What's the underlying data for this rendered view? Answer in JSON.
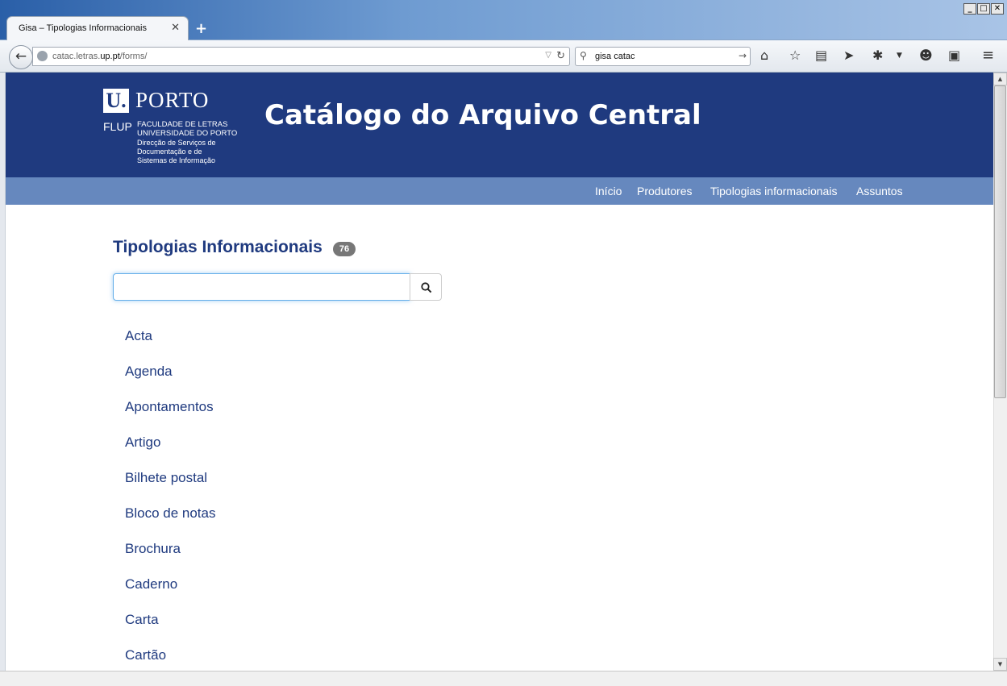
{
  "browser": {
    "tab_title": "Gisa – Tipologias Informacionais",
    "tab_close": "✕",
    "new_tab": "+",
    "url_prefix": "catac.letras.",
    "url_domain": "up.pt",
    "url_suffix": "/forms/",
    "search_query": "gisa catac",
    "window_buttons": [
      "_",
      "□",
      "✕"
    ],
    "toolbar_icons": [
      "home-icon",
      "bookmark-star-icon",
      "reading-list-icon",
      "send-icon",
      "extension-icon",
      "dropdown-icon",
      "chat-icon",
      "screenshot-icon",
      "menu-icon"
    ]
  },
  "header": {
    "logo_u": "U.",
    "logo_porto": "PORTO",
    "logo_flup": "FLUP",
    "logo_faculty_line1": "FACULDADE DE LETRAS",
    "logo_faculty_line2": "UNIVERSIDADE DO PORTO",
    "logo_dir_line1": "Direcção de Serviços de",
    "logo_dir_line2": "Documentação e de",
    "logo_dir_line3": "Sistemas de Informação",
    "title": "Catálogo do Arquivo Central"
  },
  "nav": {
    "items": [
      "Início",
      "Produtores",
      "Tipologias informacionais",
      "Assuntos"
    ]
  },
  "main": {
    "heading": "Tipologias Informacionais",
    "count": "76",
    "filter_value": "",
    "items": [
      "Acta",
      "Agenda",
      "Apontamentos",
      "Artigo",
      "Bilhete postal",
      "Bloco de notas",
      "Brochura",
      "Caderno",
      "Carta",
      "Cartão"
    ]
  },
  "colors": {
    "header_bg": "#1f3a7f",
    "nav_bg": "#6688be",
    "link": "#1f3a7f",
    "badge": "#777777"
  }
}
